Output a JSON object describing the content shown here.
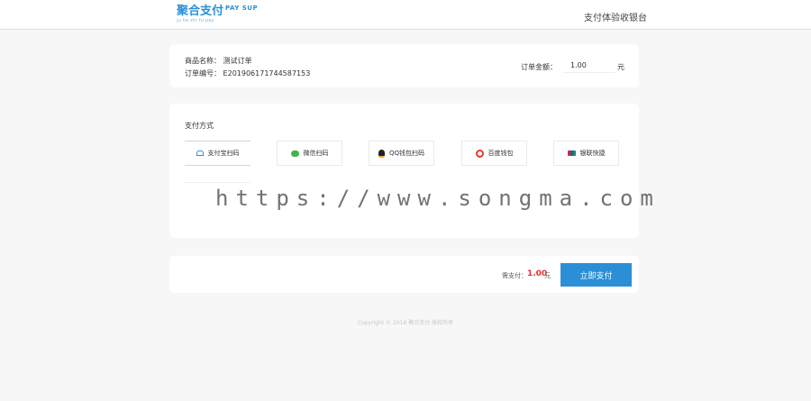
{
  "header": {
    "logo_cn": "聚合支付",
    "logo_en": "PAY SUP",
    "logo_sub": "ju he zhi fu pay",
    "title": "支付体验收银台"
  },
  "order": {
    "product_label": "商品名称：",
    "product_value": "测试订单",
    "order_no_label": "订单编号：",
    "order_no_value": "E20190617174458715З",
    "amount_label": "订单金额：",
    "amount_value": "1.00",
    "amount_unit": "元"
  },
  "payment": {
    "title": "支付方式",
    "methods": [
      {
        "label": "支付宝扫码",
        "icon": "alipay-icon"
      },
      {
        "label": "微信扫码",
        "icon": "wechat-icon"
      },
      {
        "label": "QQ钱包扫码",
        "icon": "qq-icon"
      },
      {
        "label": "百度钱包",
        "icon": "baidu-wallet-icon"
      },
      {
        "label": "银联快捷",
        "icon": "unionpay-icon"
      }
    ]
  },
  "submit": {
    "total_label": "需支付：",
    "total_value": "1.00",
    "total_unit": "元",
    "button_label": "立即支付"
  },
  "footer": {
    "copyright": "Copyright © 2018 聚合支付 版权所有"
  },
  "watermark": "https://www.songma.com",
  "colors": {
    "accent": "#2a8fd6",
    "price": "#e5302a"
  }
}
